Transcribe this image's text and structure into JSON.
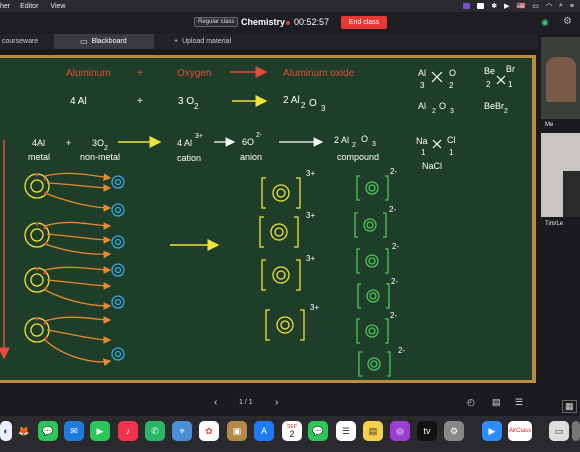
{
  "menubar": {
    "items": [
      "her",
      "Editor",
      "View"
    ],
    "flag": "🇺🇸"
  },
  "header": {
    "class_type": "Regular class",
    "title": "Chemistry",
    "timer": "00:52:57",
    "end_button": "End class"
  },
  "tabs": [
    {
      "label": "courseware"
    },
    {
      "label": "Blackboard"
    },
    {
      "label": "Upload material"
    }
  ],
  "board": {
    "row1": {
      "a": "Aluminum",
      "plus": "+",
      "b": "Oxygen",
      "c": "Aluminum oxide"
    },
    "row2": {
      "a": "4 Al",
      "plus": "+",
      "b": "3 O",
      "b_sub": "2",
      "c": "2 Al",
      "c_sub1": "2",
      "c_mid": "O",
      "c_sub2": "3"
    },
    "row3": {
      "a": "4Al",
      "plus": "+",
      "b": "3O",
      "b_sub": "2",
      "c": "4 Al",
      "c_sup": "3+",
      "d": "6O",
      "d_sup": "2-",
      "e": "2 Al",
      "e_sub1": "2",
      "e_mid": "O",
      "e_sub2": "3"
    },
    "row3_labels": {
      "a": "metal",
      "b": "non-metal",
      "c": "cation",
      "d": "anion",
      "e": "compound"
    },
    "side": {
      "al": "Al",
      "al_sub": "3",
      "o": "O",
      "o_sub": "2",
      "al2o3": "Al",
      "al2o3_s1": "2",
      "al2o3_o": "O",
      "al2o3_s2": "3",
      "be": "Be",
      "be_sub": "2",
      "br": "Br",
      "br_sub": "1",
      "bebr": "BeBr",
      "bebr_sub": "2",
      "na": "Na",
      "na_sub": "1",
      "cl": "Cl",
      "cl_sub": "1",
      "nacl": "NaCl"
    },
    "cation_charge": "3+",
    "anion_charge": "2-"
  },
  "pager": {
    "page": "1 / 1"
  },
  "videos": [
    {
      "label": "Me"
    },
    {
      "label": "Tim/Le"
    }
  ],
  "dock": {
    "calendar_month": "SEP",
    "calendar_day": "2",
    "airclass": "AirClass"
  }
}
